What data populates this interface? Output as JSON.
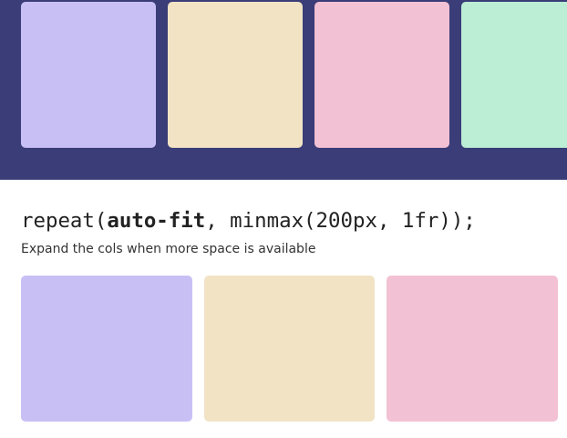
{
  "demo_top": {
    "tile_colors": [
      "#c8c0f5",
      "#f2e3c5",
      "#f3c1d4",
      "#bcedd5"
    ]
  },
  "demo_auto_fit": {
    "code": {
      "prefix": "repeat(",
      "keyword": "auto-fit",
      "suffix": ", minmax(200px, 1fr));"
    },
    "description": "Expand the cols when more space is available",
    "tile_colors": [
      "#c8c0f5",
      "#f2e3c5",
      "#f3c1d4"
    ]
  }
}
